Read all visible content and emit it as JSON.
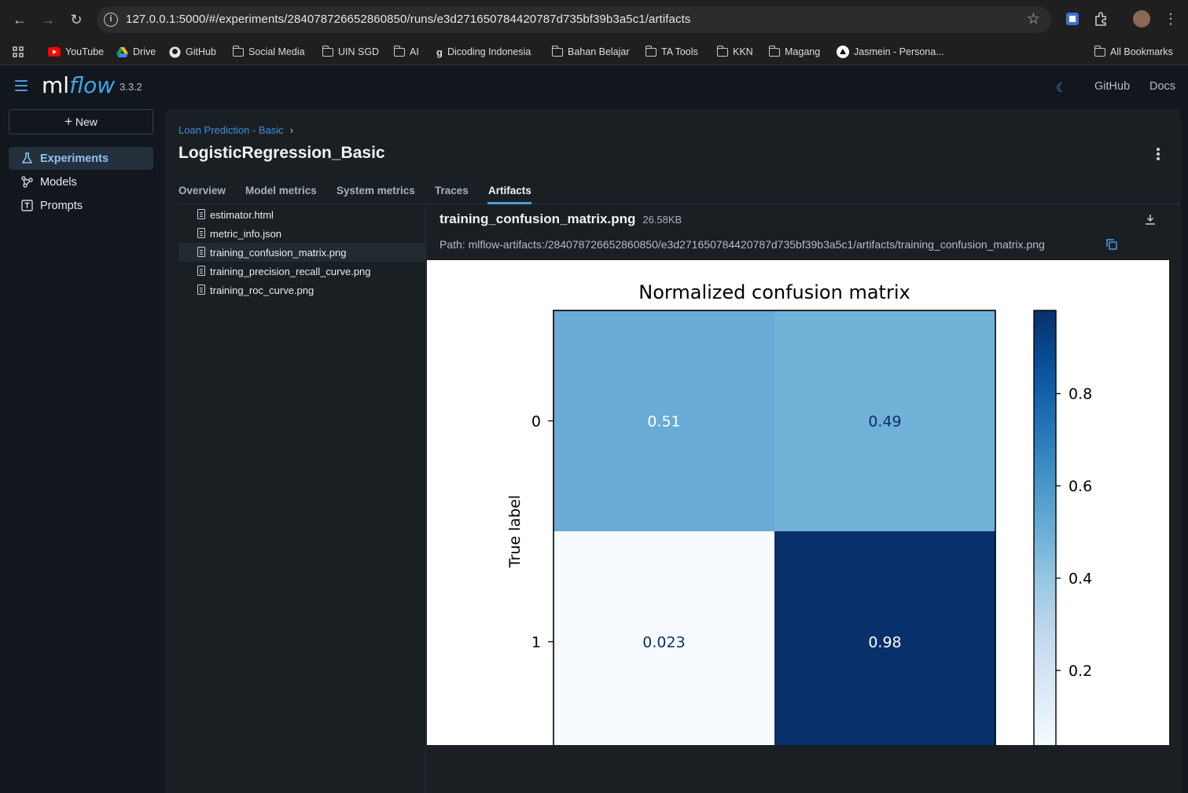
{
  "browser": {
    "url": "127.0.0.1:5000/#/experiments/284078726652860850/runs/e3d271650784420787d735bf39b3a5c1/artifacts",
    "bookmarks": [
      "YouTube",
      "Drive",
      "GitHub",
      "Social Media",
      "UIN SGD",
      "AI",
      "Dicoding Indonesia",
      "Bahan Belajar",
      "TA Tools",
      "KKN",
      "Magang",
      "Jasmein - Persona..."
    ],
    "all_bookmarks": "All Bookmarks"
  },
  "header": {
    "logo_ml": "ml",
    "logo_flow": "flow",
    "version": "3.3.2",
    "links": [
      "GitHub",
      "Docs"
    ]
  },
  "sidebar": {
    "new_label": "New",
    "items": [
      {
        "label": "Experiments",
        "icon": "beaker-icon",
        "active": true
      },
      {
        "label": "Models",
        "icon": "models-icon",
        "active": false
      },
      {
        "label": "Prompts",
        "icon": "prompts-icon",
        "active": false
      }
    ]
  },
  "run": {
    "breadcrumb": "Loan Prediction - Basic",
    "title": "LogisticRegression_Basic",
    "tabs": [
      "Overview",
      "Model metrics",
      "System metrics",
      "Traces",
      "Artifacts"
    ],
    "active_tab": "Artifacts"
  },
  "artifacts": {
    "files": [
      {
        "name": "estimator.html",
        "selected": false
      },
      {
        "name": "metric_info.json",
        "selected": false
      },
      {
        "name": "training_confusion_matrix.png",
        "selected": true
      },
      {
        "name": "training_precision_recall_curve.png",
        "selected": false
      },
      {
        "name": "training_roc_curve.png",
        "selected": false
      }
    ],
    "viewer": {
      "file_name": "training_confusion_matrix.png",
      "file_size": "26.58KB",
      "path": "Path: mlflow-artifacts:/284078726652860850/e3d271650784420787d735bf39b3a5c1/artifacts/training_confusion_matrix.png"
    }
  },
  "chart_data": {
    "type": "heatmap",
    "title": "Normalized confusion matrix",
    "ylabel": "True label",
    "xlabel": "",
    "rows": [
      "0",
      "1"
    ],
    "values": [
      [
        0.51,
        0.49
      ],
      [
        0.023,
        0.98
      ]
    ],
    "value_labels": [
      [
        "0.51",
        "0.49"
      ],
      [
        "0.023",
        "0.98"
      ]
    ],
    "colorbar_ticks": [
      "0.2",
      "0.4",
      "0.6",
      "0.8"
    ],
    "colorbar_tick_values": [
      0.2,
      0.4,
      0.6,
      0.8
    ],
    "colorbar_range": [
      0.023,
      0.98
    ],
    "colormap": "Blues"
  }
}
